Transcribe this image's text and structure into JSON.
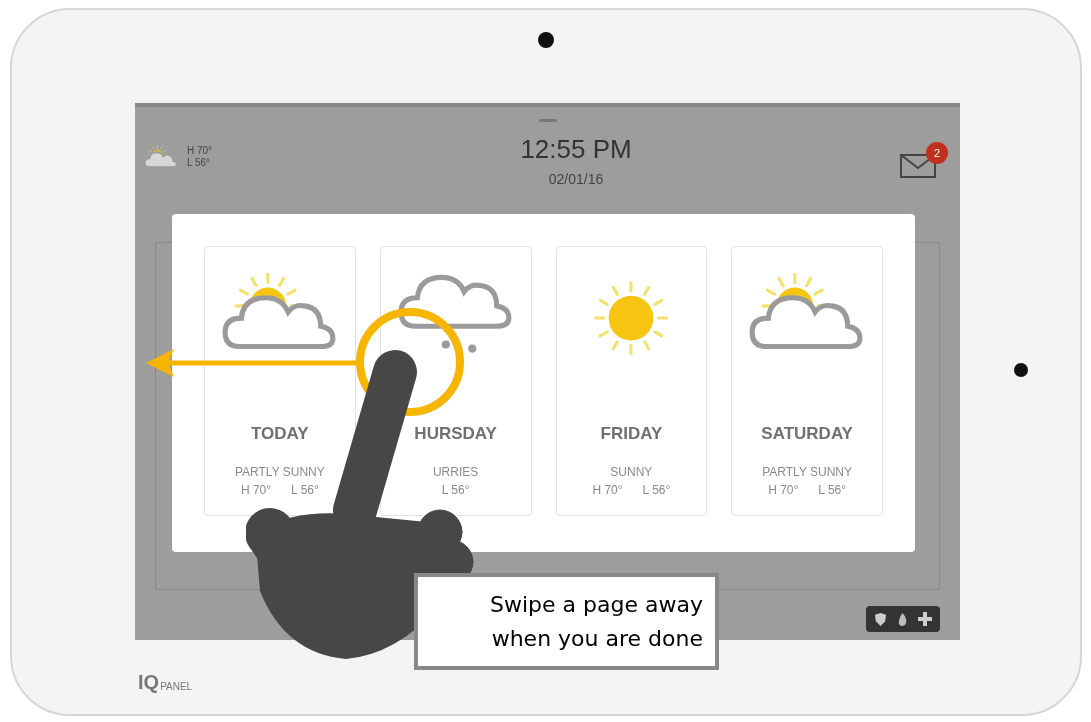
{
  "header": {
    "weather": {
      "kind": "partly_sunny"
    },
    "high": "H 70°",
    "low": "L 56°",
    "time": "12:55 PM",
    "date": "02/01/16",
    "message_count": "2"
  },
  "forecast": [
    {
      "kind": "partly_sunny",
      "day": "TODAY",
      "condition": "PARTLY SUNNY",
      "high": "H 70°",
      "low": "L 56°"
    },
    {
      "kind": "flurries",
      "day": "HURSDAY",
      "condition": "URRIES",
      "low": "L 56°"
    },
    {
      "kind": "sunny",
      "day": "FRIDAY",
      "condition": "SUNNY",
      "high": "H 70°",
      "low": "L 56°"
    },
    {
      "kind": "partly_sunny",
      "day": "SATURDAY",
      "condition": "PARTLY SUNNY",
      "high": "H 70°",
      "low": "L 56°"
    }
  ],
  "hint": {
    "lines": [
      "Swipe a page away",
      "when you are done"
    ]
  },
  "logo": {
    "mark": "IQ",
    "text": "PANEL"
  }
}
